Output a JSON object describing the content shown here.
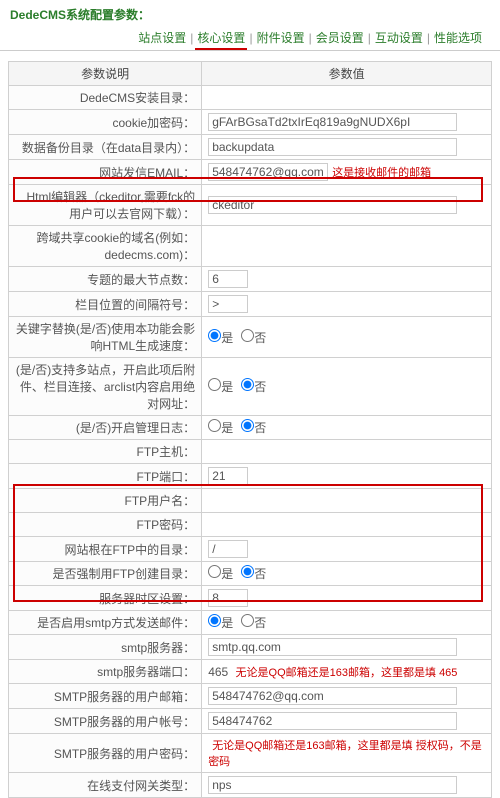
{
  "header": {
    "title": "DedeCMS系统配置参数：",
    "tabs": [
      "站点设置",
      "核心设置",
      "附件设置",
      "会员设置",
      "互动设置",
      "性能选项"
    ],
    "active_tab": 1
  },
  "columns": {
    "param": "参数说明",
    "value": "参数值"
  },
  "rows": [
    {
      "label": "DedeCMS安装目录：",
      "type": "blank"
    },
    {
      "label": "cookie加密码：",
      "type": "text",
      "value": "gFArBGsaTd2txIrEq819a9gNUDX6pI"
    },
    {
      "label": "数据备份目录（在data目录内）：",
      "type": "text",
      "value": "backupdata"
    },
    {
      "label": "网站发信EMAIL：",
      "type": "email",
      "value": "548474762@qq.com",
      "ann": "这是接收邮件的邮箱"
    },
    {
      "label": "Html编辑器（ckeditor,需要fck的用户可以去官网下载）：",
      "type": "text",
      "value": "ckeditor"
    },
    {
      "label": "跨域共享cookie的域名(例如：dedecms.com)：",
      "type": "blank"
    },
    {
      "label": "专题的最大节点数：",
      "type": "short",
      "value": "6"
    },
    {
      "label": "栏目位置的间隔符号：",
      "type": "short",
      "value": ">"
    },
    {
      "label": "关键字替换(是/否)使用本功能会影响HTML生成速度：",
      "type": "radio",
      "value": "是"
    },
    {
      "label": "(是/否)支持多站点，开启此项后附件、栏目连接、arclist内容启用绝对网址：",
      "type": "radio",
      "value": "否"
    },
    {
      "label": "(是/否)开启管理日志：",
      "type": "radio",
      "value": "否"
    },
    {
      "label": "FTP主机：",
      "type": "blank"
    },
    {
      "label": "FTP端口：",
      "type": "short",
      "value": "21"
    },
    {
      "label": "FTP用户名：",
      "type": "blank"
    },
    {
      "label": "FTP密码：",
      "type": "blank"
    },
    {
      "label": "网站根在FTP中的目录：",
      "type": "short",
      "value": "/"
    },
    {
      "label": "是否强制用FTP创建目录：",
      "type": "radio",
      "value": "否"
    },
    {
      "label": "服务器时区设置：",
      "type": "short",
      "value": "8"
    },
    {
      "label": "是否启用smtp方式发送邮件：",
      "type": "radio",
      "value": "是"
    },
    {
      "label": "smtp服务器：",
      "type": "text",
      "value": "smtp.qq.com"
    },
    {
      "label": "smtp服务器端口：",
      "type": "smtp_port",
      "value": "465",
      "ann": "无论是QQ邮箱还是163邮箱，这里都是填 465"
    },
    {
      "label": "SMTP服务器的用户邮箱：",
      "type": "text",
      "value": "548474762@qq.com"
    },
    {
      "label": "SMTP服务器的用户帐号：",
      "type": "text",
      "value": "548474762"
    },
    {
      "label": "SMTP服务器的用户密码：",
      "type": "ann_only",
      "ann": "无论是QQ邮箱还是163邮箱，这里都是填 授权码，不是密码"
    },
    {
      "label": "在线支付网关类型：",
      "type": "text",
      "value": "nps"
    }
  ],
  "radio": {
    "yes": "是",
    "no": "否"
  }
}
